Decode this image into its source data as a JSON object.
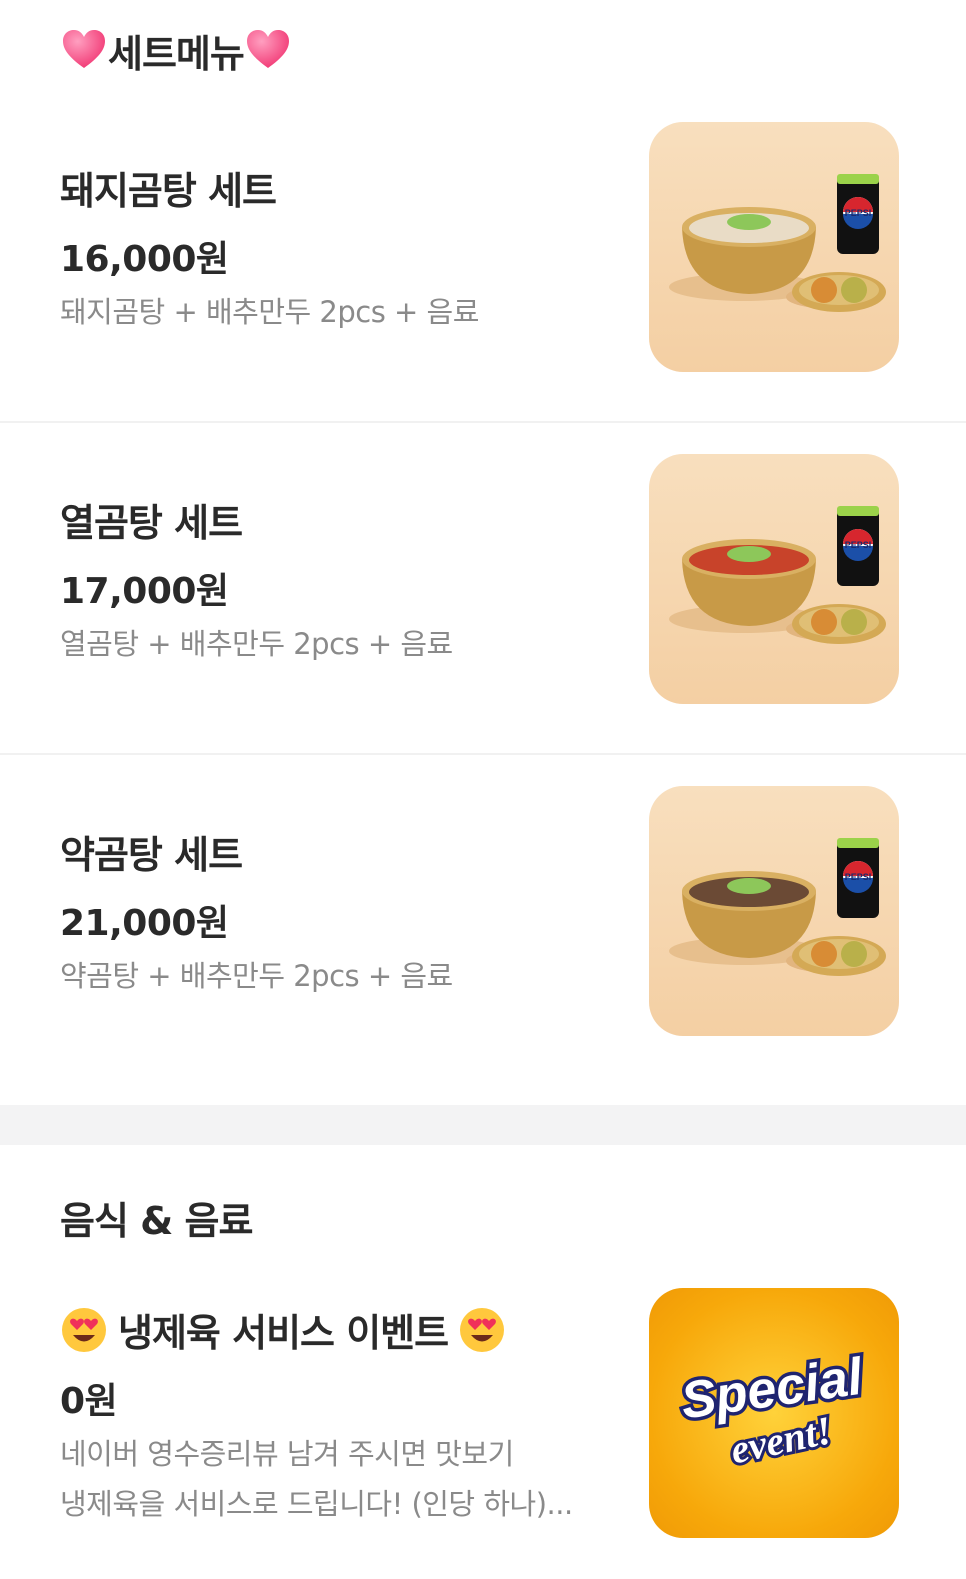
{
  "set_section": {
    "title": "세트메뉴",
    "icon": "heart-icon"
  },
  "set_items": [
    {
      "name": "돼지곰탕 세트",
      "price": "16,000원",
      "desc": "돼지곰탕 + 배추만두 2pcs + 음료",
      "soup_color": "#e9dcc6",
      "can_text": "PEPSI"
    },
    {
      "name": "열곰탕 세트",
      "price": "17,000원",
      "desc": "열곰탕 + 배추만두 2pcs + 음료",
      "soup_color": "#c8432a",
      "can_text": "PEPSI"
    },
    {
      "name": "약곰탕 세트",
      "price": "21,000원",
      "desc": "약곰탕 + 배추만두 2pcs + 음료",
      "soup_color": "#6b4a35",
      "can_text": "PEPSI"
    }
  ],
  "food_section": {
    "title": "음식 & 음료"
  },
  "food_items": [
    {
      "name": "냉제육 서비스 이벤트",
      "name_icon": "heart-eyes-emoji-icon",
      "price": "0원",
      "desc_line1": "네이버 영수증리뷰 남겨 주시면 맛보기",
      "desc_line2": "냉제육을 서비스로 드립니다! (인당 하나)...",
      "badge_line1": "Special",
      "badge_line2": "event!"
    }
  ],
  "colors": {
    "heart": "#ff4f86",
    "badge_bg": "#f7a80a",
    "badge_text": "#1f2470",
    "desc": "#8a8a8a"
  }
}
